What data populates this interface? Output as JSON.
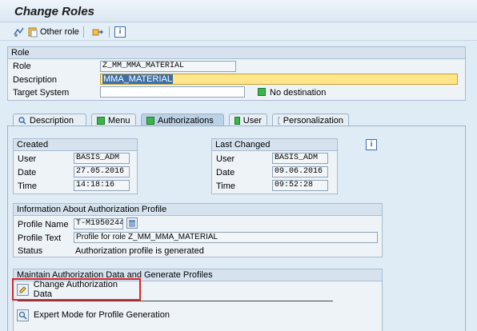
{
  "window": {
    "title": "Change Roles"
  },
  "toolbar": {
    "other_role_label": "Other role"
  },
  "role_group": {
    "header": "Role",
    "role_label": "Role",
    "role_value": "Z_MM_MMA_MATERIAL",
    "description_label": "Description",
    "description_value": "MMA_MATERIAL",
    "target_label": "Target System",
    "target_value": "",
    "no_destination": "No destination"
  },
  "tabs": [
    {
      "label": "Description",
      "icon": "description-icon"
    },
    {
      "label": "Menu",
      "icon": "status-green-icon"
    },
    {
      "label": "Authorizations",
      "icon": "status-green-icon"
    },
    {
      "label": "User",
      "icon": "status-green-icon"
    },
    {
      "label": "Personalization",
      "icon": "personalization-icon"
    }
  ],
  "created": {
    "header": "Created",
    "user_label": "User",
    "user": "BASIS_ADM",
    "date_label": "Date",
    "date": "27.05.2016",
    "time_label": "Time",
    "time": "14:18:16"
  },
  "last_changed": {
    "header": "Last Changed",
    "user_label": "User",
    "user": "BASIS_ADM",
    "date_label": "Date",
    "date": "09.06.2016",
    "time_label": "Time",
    "time": "09:52:28"
  },
  "auth_profile": {
    "header": "Information About Authorization Profile",
    "profile_name_label": "Profile Name",
    "profile_name": "T-M1950244",
    "profile_text_label": "Profile Text",
    "profile_text": "Profile for role Z_MM_MMA_MATERIAL",
    "status_label": "Status",
    "status": "Authorization profile is generated"
  },
  "maintain": {
    "header": "Maintain Authorization Data and Generate Profiles",
    "change_button": "Change Authorization Data",
    "expert_button": "Expert Mode for Profile Generation"
  },
  "colors": {
    "highlight_box": "#d9262c",
    "status_green": "#3bb54a",
    "description_highlight": "#ffe68a"
  }
}
